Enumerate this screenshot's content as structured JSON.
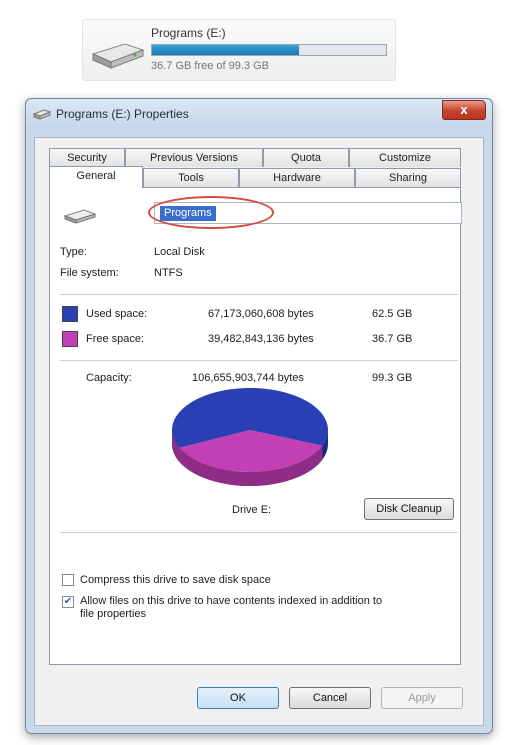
{
  "drive_tile": {
    "title": "Programs (E:)",
    "free_text": "36.7 GB free of 99.3 GB",
    "used_fraction": 0.63
  },
  "window": {
    "title": "Programs (E:) Properties",
    "close_label": "x"
  },
  "tabs_row1": [
    "Security",
    "Previous Versions",
    "Quota",
    "Customize"
  ],
  "tabs_row2": [
    "General",
    "Tools",
    "Hardware",
    "Sharing"
  ],
  "active_tab": "General",
  "general": {
    "name_value": "Programs",
    "type_label": "Type:",
    "type_value": "Local Disk",
    "fs_label": "File system:",
    "fs_value": "NTFS",
    "used": {
      "label": "Used space:",
      "bytes": "67,173,060,608 bytes",
      "size": "62.5 GB",
      "color": "#2b3fb4"
    },
    "free": {
      "label": "Free space:",
      "bytes": "39,482,843,136 bytes",
      "size": "36.7 GB",
      "color": "#c23fb6"
    },
    "capacity": {
      "label": "Capacity:",
      "bytes": "106,655,903,744 bytes",
      "size": "99.3 GB"
    },
    "drive_caption": "Drive E:",
    "cleanup_label": "Disk Cleanup",
    "compress_label": "Compress this drive to save disk space",
    "compress_checked": false,
    "index_label_line1": "Allow files on this drive to have contents indexed in addition to",
    "index_label_line2": "file properties",
    "index_checked": true
  },
  "buttons": {
    "ok": "OK",
    "cancel": "Cancel",
    "apply": "Apply"
  }
}
